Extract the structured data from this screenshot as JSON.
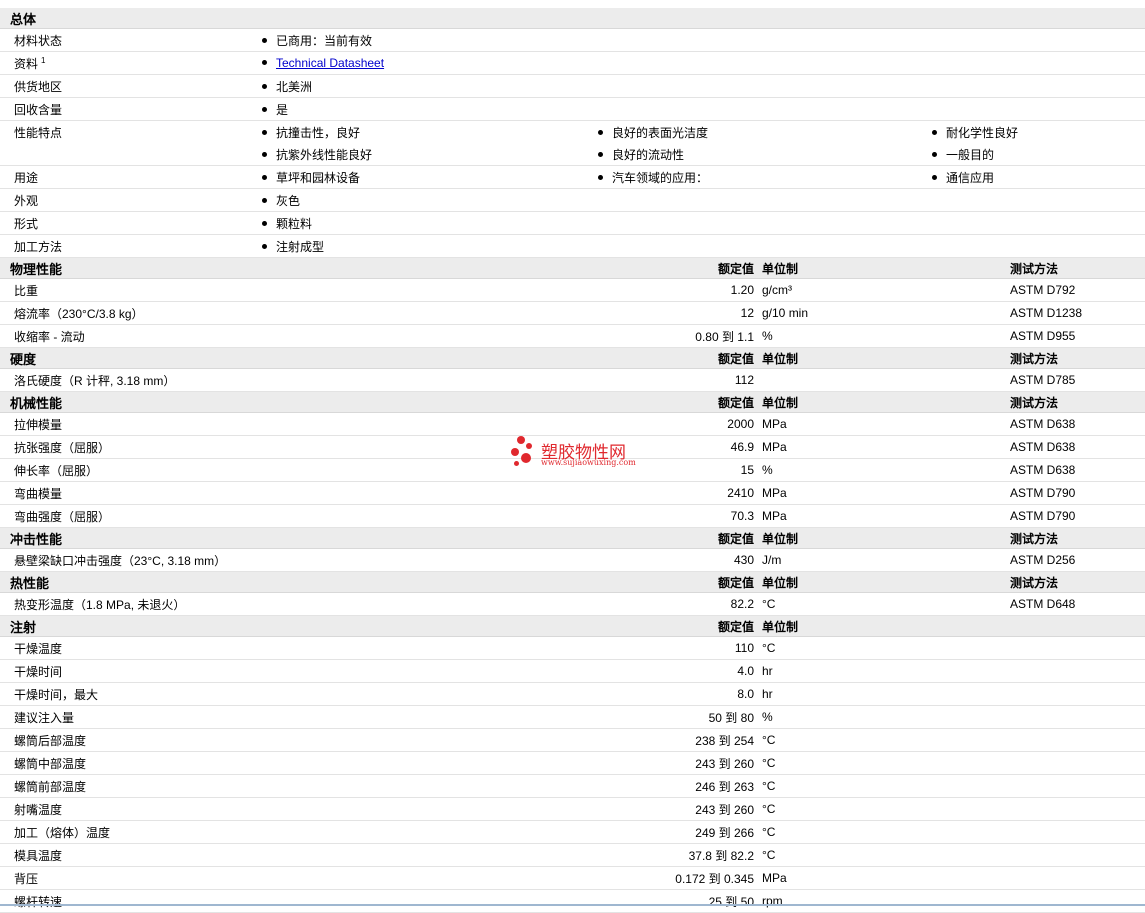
{
  "general": {
    "title": "总体",
    "rows": [
      {
        "label": "材料状态",
        "items": [
          "已商用：当前有效"
        ]
      },
      {
        "label": "资料",
        "sup": "1",
        "link": "Technical Datasheet"
      },
      {
        "label": "供货地区",
        "items": [
          "北美洲"
        ]
      },
      {
        "label": "回收含量",
        "items": [
          "是"
        ]
      },
      {
        "label": "性能特点",
        "items": [
          "抗撞击性，良好",
          "良好的表面光洁度",
          "耐化学性良好",
          "抗紫外线性能良好",
          "良好的流动性",
          "一般目的"
        ]
      },
      {
        "label": "用途",
        "items": [
          "草坪和园林设备",
          "汽车领域的应用：",
          "通信应用"
        ]
      },
      {
        "label": "外观",
        "items": [
          "灰色"
        ]
      },
      {
        "label": "形式",
        "items": [
          "颗粒料"
        ]
      },
      {
        "label": "加工方法",
        "items": [
          "注射成型"
        ]
      }
    ]
  },
  "headers": {
    "value": "额定值",
    "unit": "单位制",
    "method": "测试方法"
  },
  "sections": [
    {
      "title": "物理性能",
      "rows": [
        {
          "label": "比重",
          "value": "1.20",
          "unit": "g/cm³",
          "method": "ASTM D792"
        },
        {
          "label": "熔流率（230°C/3.8 kg）",
          "value": "12",
          "unit": "g/10 min",
          "method": "ASTM D1238"
        },
        {
          "label": "收缩率 - 流动",
          "value": "0.80 到  1.1",
          "unit": "%",
          "method": "ASTM D955"
        }
      ]
    },
    {
      "title": "硬度",
      "rows": [
        {
          "label": "洛氏硬度（R 计秤, 3.18 mm）",
          "value": "112",
          "unit": "",
          "method": "ASTM D785"
        }
      ]
    },
    {
      "title": "机械性能",
      "rows": [
        {
          "label": "拉伸模量",
          "value": "2000",
          "unit": "MPa",
          "method": "ASTM D638"
        },
        {
          "label": "抗张强度（屈服）",
          "value": "46.9",
          "unit": "MPa",
          "method": "ASTM D638"
        },
        {
          "label": "伸长率（屈服）",
          "value": "15",
          "unit": "%",
          "method": "ASTM D638"
        },
        {
          "label": "弯曲模量",
          "value": "2410",
          "unit": "MPa",
          "method": "ASTM D790"
        },
        {
          "label": "弯曲强度（屈服）",
          "value": "70.3",
          "unit": "MPa",
          "method": "ASTM D790"
        }
      ]
    },
    {
      "title": "冲击性能",
      "rows": [
        {
          "label": "悬壁梁缺口冲击强度（23°C, 3.18 mm）",
          "value": "430",
          "unit": "J/m",
          "method": "ASTM D256"
        }
      ]
    },
    {
      "title": "热性能",
      "rows": [
        {
          "label": "热变形温度（1.8 MPa, 未退火）",
          "value": "82.2",
          "unit": "°C",
          "method": "ASTM D648"
        }
      ]
    },
    {
      "title": "注射",
      "no_method": true,
      "rows": [
        {
          "label": "干燥温度",
          "value": "110",
          "unit": "°C",
          "method": ""
        },
        {
          "label": "干燥时间",
          "value": "4.0",
          "unit": "hr",
          "method": ""
        },
        {
          "label": "干燥时间，最大",
          "value": "8.0",
          "unit": "hr",
          "method": ""
        },
        {
          "label": "建议注入量",
          "value": "50 到  80",
          "unit": "%",
          "method": ""
        },
        {
          "label": "螺筒后部温度",
          "value": "238 到  254",
          "unit": "°C",
          "method": ""
        },
        {
          "label": "螺筒中部温度",
          "value": "243 到  260",
          "unit": "°C",
          "method": ""
        },
        {
          "label": "螺筒前部温度",
          "value": "246 到  263",
          "unit": "°C",
          "method": ""
        },
        {
          "label": "射嘴温度",
          "value": "243 到  260",
          "unit": "°C",
          "method": ""
        },
        {
          "label": "加工（熔体）温度",
          "value": "249 到  266",
          "unit": "°C",
          "method": ""
        },
        {
          "label": "模具温度",
          "value": "37.8 到  82.2",
          "unit": "°C",
          "method": ""
        },
        {
          "label": "背压",
          "value": "0.172 到  0.345",
          "unit": "MPa",
          "method": ""
        },
        {
          "label": "螺杆转速",
          "value": "25 到  50",
          "unit": "rpm",
          "method": ""
        }
      ]
    }
  ],
  "watermark": {
    "name": "塑胶物性网",
    "url": "www.sujiaowuxing.com",
    "color": "#e0282e"
  }
}
